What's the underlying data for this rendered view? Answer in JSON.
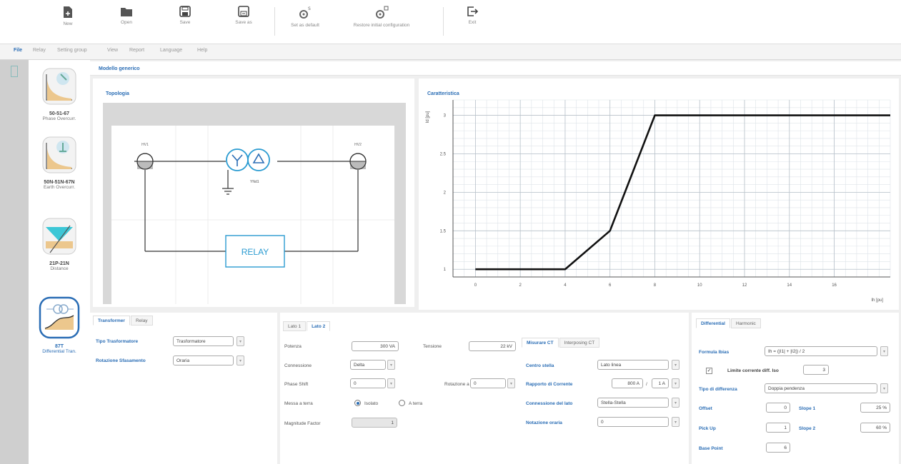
{
  "toolbar": {
    "new": "New",
    "open": "Open",
    "save": "Save",
    "save_as": "Save as",
    "set_default": "Set as default",
    "restore_config": "Restore initial configuration",
    "exit": "Exit"
  },
  "menu": {
    "file": "File",
    "relay": "Relay",
    "setting_group": "Setting group",
    "view": "View",
    "report": "Report",
    "language": "Language",
    "help": "Help"
  },
  "left_panel": {
    "items": [
      {
        "title": "50-51-67",
        "subtitle": "Phase Overcurr."
      },
      {
        "title": "50N-51N-67N",
        "subtitle": "Earth Overcurr."
      },
      {
        "title": "21P-21N",
        "subtitle": "Distance"
      },
      {
        "title": "87T",
        "subtitle": "Differential Tran."
      }
    ]
  },
  "main": {
    "header": "Modello generico"
  },
  "topology": {
    "title": "Topologia",
    "left_ct": "HV1",
    "right_ct": "HV2",
    "transformer_label": "YNd1",
    "relay_label": "RELAY"
  },
  "chart_data": {
    "type": "line",
    "title": "Caratteristica",
    "ylabel": "Id [pu]",
    "xlabel": "Ih [pu]",
    "xlim": [
      -1,
      18.5
    ],
    "ylim": [
      0.9,
      3.2
    ],
    "x_ticks": [
      "0",
      "2",
      "4",
      "6",
      "8",
      "10",
      "12",
      "14",
      "16"
    ],
    "y_ticks": [
      "1",
      "1.5",
      "2",
      "2.5",
      "3"
    ],
    "x": [
      0,
      4,
      6,
      8,
      18.5
    ],
    "y": [
      1,
      1,
      1.5,
      3,
      3
    ],
    "grid": true
  },
  "transformer_panel": {
    "tabs": [
      "Transformer",
      "Relay"
    ],
    "type_label": "Tipo Trasformatore",
    "type_value": "Trasformatore",
    "rotation_label": "Rotazione Sfasamento",
    "rotation_value": "Oraria"
  },
  "side_panel": {
    "tabs": [
      "Lato 1",
      "Lato 2"
    ],
    "potenza_label": "Potenza",
    "potenza_value": "300 VA",
    "tensione_label": "Tensione",
    "tensione_value": "22 kV",
    "connessione_label": "Connessione",
    "connessione_value": "Delta",
    "phase_shift_label": "Phase Shift",
    "phase_shift_value": "0",
    "rotazione_label": "Rotazione a",
    "rotazione_value": "0",
    "messa_terra_label": "Messa a terra",
    "isolato_label": "Isolato",
    "a_terra_label": "A terra",
    "magnitude_label": "Magnitude Factor",
    "magnitude_value": "1"
  },
  "ct_panel": {
    "tabs": [
      "Misurare CT",
      "Interposing CT"
    ],
    "centro_label": "Centro stella",
    "centro_value": "Lato linea",
    "rapporto_label": "Rapporto di Corrente",
    "rapporto_primary": "800 A",
    "rapporto_sep": "/",
    "rapporto_secondary": "1 A",
    "connessione_lato_label": "Connessione del lato",
    "connessione_lato_value": "Stella-Stella",
    "notazione_label": "Notazione oraria",
    "notazione_value": "0"
  },
  "diff_panel": {
    "tabs": [
      "Differential",
      "Harmonic"
    ],
    "formula_label": "Formula Ibias",
    "formula_value": "Ih = (|I1| + |I2|) / 2",
    "limite_label": "Limite corrente diff. Iso",
    "limite_value": "3",
    "tipo_label": "Tipo di differenza",
    "tipo_value": "Doppia pendenza",
    "offset_label": "Offset",
    "offset_value": "0",
    "slope1_label": "Slope 1",
    "slope1_value": "25 %",
    "pickup_label": "Pick Up",
    "pickup_value": "1",
    "slope2_label": "Slope 2",
    "slope2_value": "60 %",
    "base_label": "Base Point",
    "base_value": "6"
  }
}
